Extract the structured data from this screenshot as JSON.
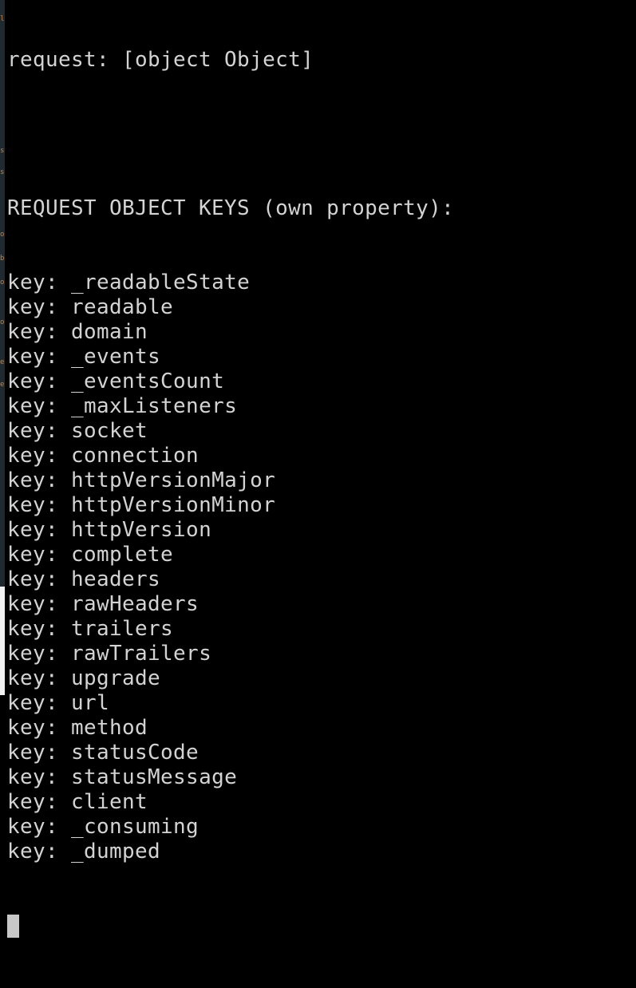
{
  "terminal": {
    "request_line": "request: [object Object]",
    "blank_line": "",
    "header_line": "REQUEST OBJECT KEYS (own property):",
    "key_prefix": "key: ",
    "keys": [
      "_readableState",
      "readable",
      "domain",
      "_events",
      "_eventsCount",
      "_maxListeners",
      "socket",
      "connection",
      "httpVersionMajor",
      "httpVersionMinor",
      "httpVersion",
      "complete",
      "headers",
      "rawHeaders",
      "trailers",
      "rawTrailers",
      "upgrade",
      "url",
      "method",
      "statusCode",
      "statusMessage",
      "client",
      "_consuming",
      "_dumped"
    ],
    "colors": {
      "background": "#000000",
      "text": "#d3d3d3",
      "cursor": "#c8c8c8"
    }
  }
}
